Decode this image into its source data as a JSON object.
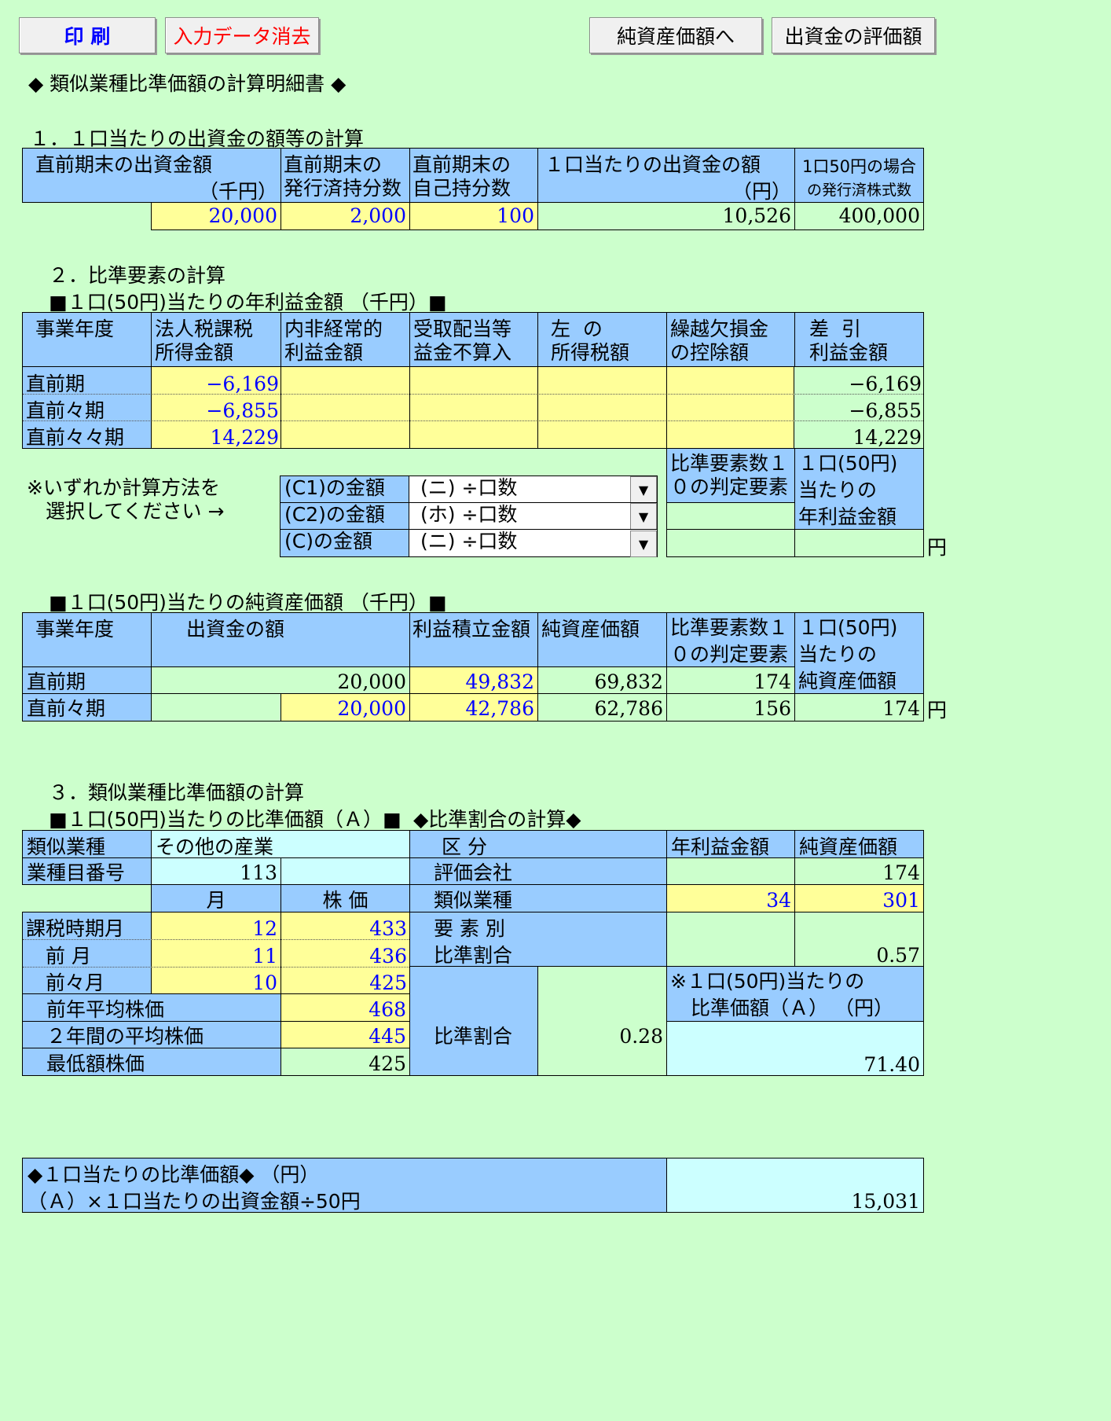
{
  "buttons": {
    "print": "印 刷",
    "clear": "入力データ消去",
    "net_assets": "純資産価額へ",
    "evaluation": "出資金の評価額"
  },
  "title": "◆ 類似業種比準価額の計算明細書 ◆",
  "sec1": {
    "heading": "１．１口当たりの出資金の額等の計算",
    "h1a": "直前期末の出資金額",
    "h1b": "（千円）",
    "h2a": "直前期末の",
    "h2b": "発行済持分数",
    "h3a": "直前期末の",
    "h3b": "自己持分数",
    "h4a": "１口当たりの出資金の額",
    "h4b": "（円）",
    "h5a": "1口50円の場合",
    "h5b": "の発行済株式数",
    "v1": "20,000",
    "v2": "2,000",
    "v3": "100",
    "v4": "10,526",
    "v5": "400,000"
  },
  "sec2": {
    "heading": "２．比準要素の計算",
    "profit_title": "■１口(50円)当たりの年利益金額 （千円）■",
    "ph0": "事業年度",
    "ph1a": "法人税課税",
    "ph1b": "所得金額",
    "ph2a": "内非経常的",
    "ph2b": "利益金額",
    "ph3a": "受取配当等",
    "ph3b": "益金不算入",
    "ph4a": "左  の",
    "ph4b": "所得税額",
    "ph5a": "繰越欠損金",
    "ph5b": "の控除額",
    "ph6a": "差  引",
    "ph6b": "利益金額",
    "rows": [
      {
        "label": "直前期",
        "income": "−6,169",
        "diff": "−6,169"
      },
      {
        "label": "直前々期",
        "income": "−6,855",
        "diff": "−6,855"
      },
      {
        "label": "直前々々期",
        "income": "14,229",
        "diff": "14,229"
      }
    ],
    "note1": "※いずれか計算方法を",
    "note2": "選択してください →",
    "c1_label": "(C1)の金額",
    "c1_value": "(ニ) ÷口数",
    "c2_label": "(C2)の金額",
    "c2_value": "(ホ) ÷口数",
    "c_label": "(C)の金額",
    "c_value": "(ニ) ÷口数",
    "judge_a": "比準要素数１・",
    "judge_b": "０の判定要素",
    "per_a": "１口(50円)",
    "per_b": "当たりの",
    "per_c": "年利益金額",
    "yen": "円",
    "net_title": "■１口(50円)当たりの純資産価額 （千円）■",
    "nh0": "事業年度",
    "nh1": "出資金の額",
    "nh2": "利益積立金額",
    "nh3": "純資産価額",
    "nh4a": "比準要素数１・",
    "nh4b": "０の判定要素",
    "nh5a": "１口(50円)",
    "nh5b": "当たりの",
    "nh5c": "純資産価額",
    "net_rows": [
      {
        "label": "直前期",
        "capital": "20,000",
        "reserve": "49,832",
        "net": "69,832",
        "judge": "174"
      },
      {
        "label": "直前々期",
        "capital": "20,000",
        "reserve": "42,786",
        "net": "62,786",
        "judge": "156"
      }
    ],
    "net_per": "174",
    "net_yen": "円"
  },
  "sec3": {
    "heading": "３．類似業種比準価額の計算",
    "sub_a": "■１口(50円)当たりの比準価額（Ａ）■",
    "sub_b": "◆比準割合の計算◆",
    "industry_label": "類似業種",
    "industry_value": "その他の産業",
    "code_label": "業種目番号",
    "code_value": "113",
    "month_h": "月",
    "price_h": "株 価",
    "rows": [
      {
        "label": "課税時期月",
        "month": "12",
        "price": "433"
      },
      {
        "label": "前 月",
        "month": "11",
        "price": "436"
      },
      {
        "label": "前々月",
        "month": "10",
        "price": "425"
      }
    ],
    "avg_year_label": "前年平均株価",
    "avg_year": "468",
    "avg_2y_label": "２年間の平均株価",
    "avg_2y": "445",
    "min_label": "最低額株価",
    "min_value": "425",
    "kubun": "区 分",
    "profit_h": "年利益金額",
    "net_h": "純資産価額",
    "eval_label": "評価会社",
    "eval_net": "174",
    "similar_label": "類似業種",
    "similar_profit": "34",
    "similar_net": "301",
    "elem_a": "要 素 別",
    "elem_b": "比準割合",
    "elem_net": "0.57",
    "ratio_label": "比準割合",
    "ratio_value": "0.28",
    "a_note_a": "※１口(50円)当たりの",
    "a_note_b": "比準価額（Ａ） （円）",
    "a_value": "71.40"
  },
  "final": {
    "label_a": "◆１口当たりの比準価額◆ （円）",
    "label_b": "（Ａ）×１口当たりの出資金額÷50円",
    "value": "15,031"
  },
  "colors": {
    "background": "#ccffcc",
    "header_blue": "#99ccff",
    "input_yellow": "#ffff99",
    "result_cyan": "#ccffff",
    "input_text": "#0000ff",
    "clear_text": "#ff0000",
    "print_text": "#0000ff"
  }
}
